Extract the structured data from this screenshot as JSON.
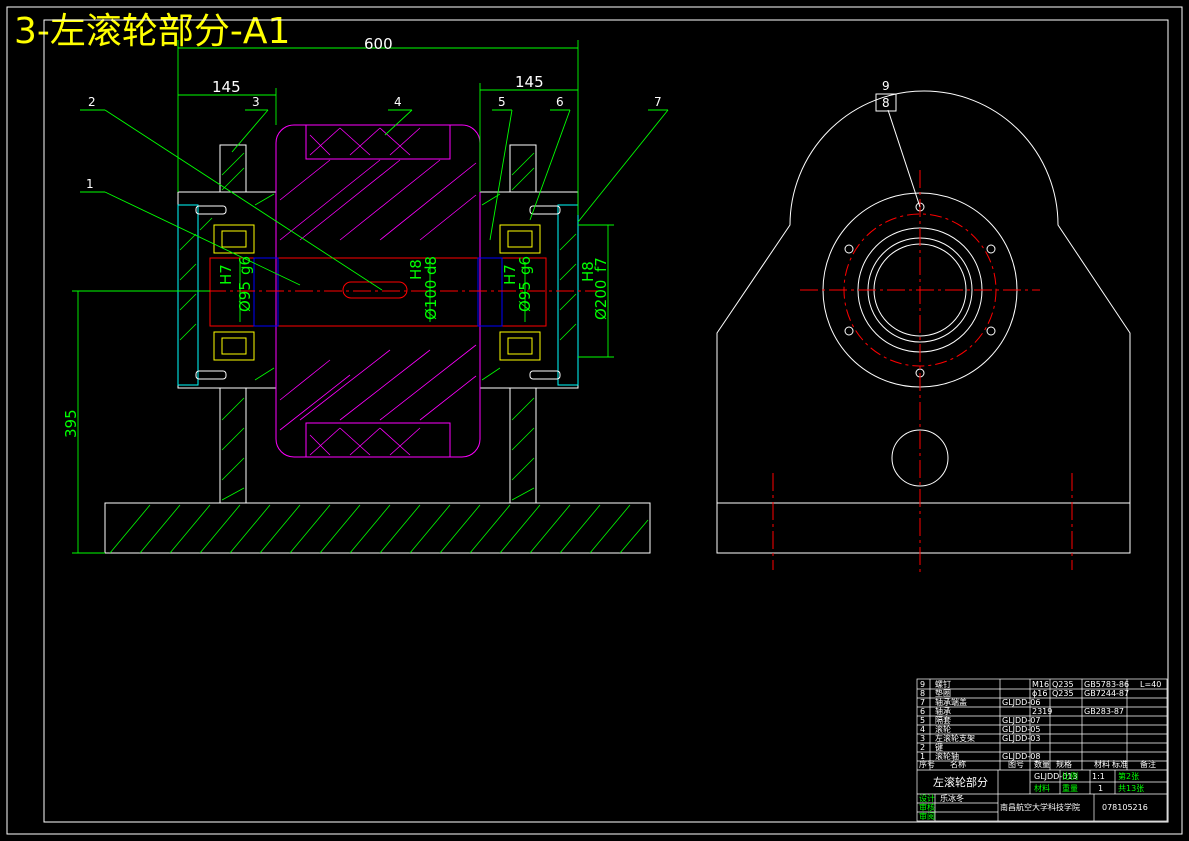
{
  "title": "3-左滚轮部分-A1",
  "dimensions": {
    "overall_width": "600",
    "left_width": "145",
    "right_width": "145",
    "height": "395",
    "bore_left": "Ø95",
    "bore_left_fit": "H7",
    "bore_left_fit2": "g6",
    "shaft": "Ø100",
    "shaft_fit": "H8",
    "shaft_fit2": "d8",
    "bore_right": "Ø95",
    "bore_right_fit": "H7",
    "bore_right_fit2": "g6",
    "housing": "Ø200",
    "housing_fit": "H8",
    "housing_fit2": "f7"
  },
  "balloons": [
    "1",
    "2",
    "3",
    "4",
    "5",
    "6",
    "7",
    "8",
    "9"
  ],
  "title_block": {
    "parts": [
      {
        "no": "9",
        "name": "螺钉",
        "code": "",
        "qty": "",
        "spec": "M16",
        "material": "Q235",
        "std": "GB5783-86",
        "note": "L=40"
      },
      {
        "no": "8",
        "name": "垫圈",
        "code": "",
        "qty": "",
        "spec": "ϕ16",
        "material": "Q235",
        "std": "GB7244-87",
        "note": ""
      },
      {
        "no": "7",
        "name": "轴承端盖",
        "code": "GLJDD-06",
        "qty": "",
        "spec": "",
        "material": "",
        "std": "",
        "note": ""
      },
      {
        "no": "6",
        "name": "轴承",
        "code": "",
        "qty": "",
        "spec": "2319",
        "material": "",
        "std": "GB283-87",
        "note": ""
      },
      {
        "no": "5",
        "name": "隔套",
        "code": "GLJDD-07",
        "qty": "",
        "spec": "",
        "material": "",
        "std": "",
        "note": ""
      },
      {
        "no": "4",
        "name": "滚轮",
        "code": "GLJDD-05",
        "qty": "",
        "spec": "",
        "material": "",
        "std": "",
        "note": ""
      },
      {
        "no": "3",
        "name": "左滚轮支架",
        "code": "GLJDD-03",
        "qty": "",
        "spec": "",
        "material": "",
        "std": "",
        "note": ""
      },
      {
        "no": "2",
        "name": "键",
        "code": "",
        "qty": "",
        "spec": "",
        "material": "",
        "std": "",
        "note": ""
      },
      {
        "no": "1",
        "name": "滚轮轴",
        "code": "GLJDD-08",
        "qty": "",
        "spec": "",
        "material": "",
        "std": "",
        "note": ""
      }
    ],
    "header": [
      "序号",
      "名称",
      "图号",
      "数量",
      "规格",
      "材料",
      "标准",
      "备注"
    ],
    "drawing_name": "左滚轮部分",
    "drawing_no": "GLJDD-013",
    "scale_label": "比例",
    "scale": "1:1",
    "sheet_label": "第2张",
    "total_label": "共13张",
    "weight_label": "重量",
    "material_label": "材料",
    "qty": "1",
    "designer_label": "设计",
    "designer": "乐冰冬",
    "checker_label": "审核",
    "approver_label": "审阅",
    "school": "南昌航空大学科技学院",
    "student_no": "078105216"
  },
  "colors": {
    "background": "#000000",
    "outline": "#ffffff",
    "dimension": "#00ff00",
    "roller": "#ff00ff",
    "centerline": "#ff0000",
    "housing": "#00ffff",
    "shaft": "#0000ff",
    "title": "#ffff00"
  }
}
